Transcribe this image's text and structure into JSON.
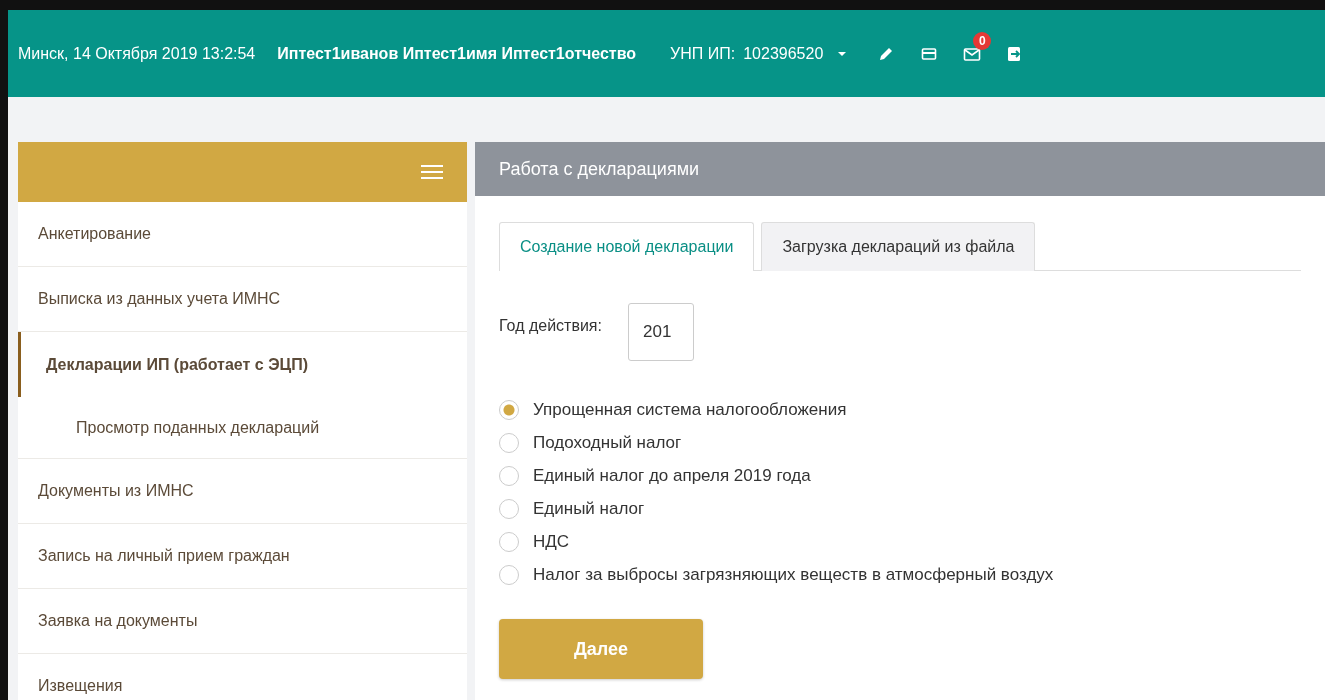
{
  "header": {
    "location_datetime": "Минск, 14 Октября 2019 13:2:54",
    "user_name": "Иптест1иванов Иптест1имя Иптест1отчество",
    "unp_label": "УНП ИП:",
    "unp_value": "102396520",
    "notifications_badge": "0"
  },
  "sidebar": {
    "items": [
      {
        "label": "Анкетирование",
        "selected": false
      },
      {
        "label": "Выписка из данных учета ИМНС",
        "selected": false
      },
      {
        "label": "Декларации ИП (работает с ЭЦП)",
        "selected": true,
        "children": [
          {
            "label": "Просмотр поданных деклараций",
            "selected": false
          }
        ]
      },
      {
        "label": "Документы из ИМНС",
        "selected": false
      },
      {
        "label": "Запись на личный прием граждан",
        "selected": false
      },
      {
        "label": "Заявка на документы",
        "selected": false
      },
      {
        "label": "Извещения",
        "selected": false
      }
    ]
  },
  "panel": {
    "title": "Работа с декларациями",
    "tabs": [
      {
        "label": "Создание новой декларации",
        "selected": true
      },
      {
        "label": "Загрузка деклараций из файла",
        "selected": false
      }
    ],
    "year_label": "Год действия:",
    "year_value": "201",
    "options": [
      {
        "label": "Упрощенная система налогообложения",
        "selected": true
      },
      {
        "label": "Подоходный налог",
        "selected": false
      },
      {
        "label": "Единый налог до апреля 2019 года",
        "selected": false
      },
      {
        "label": "Единый налог",
        "selected": false
      },
      {
        "label": "НДС",
        "selected": false
      },
      {
        "label": "Налог за выбросы загрязняющих веществ в атмосферный воздух",
        "selected": false
      }
    ],
    "next_button": "Далее"
  }
}
